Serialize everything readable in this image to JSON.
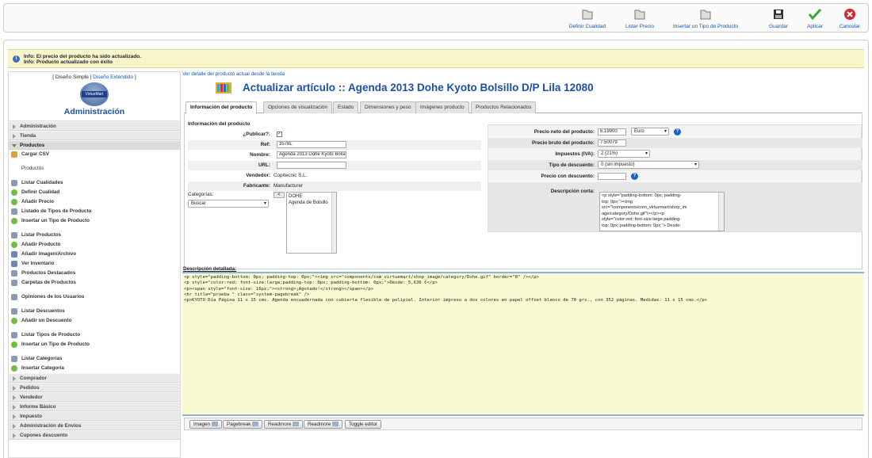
{
  "toolbar": {
    "buttons": [
      {
        "label": "Definir Cualidad",
        "icon": "folder-icon"
      },
      {
        "label": "Listar Precio",
        "icon": "folder-icon"
      },
      {
        "label": "Insertar un Tipo de Producto",
        "icon": "folder-icon"
      },
      {
        "label": "Guardar",
        "icon": "floppy-icon"
      },
      {
        "label": "Aplicar",
        "icon": "checkmark-icon"
      },
      {
        "label": "Cancelar",
        "icon": "cancel-icon"
      }
    ]
  },
  "messages": [
    "Info: El precio del producto ha sido actualizado.",
    "Info: Producto actualizado con éxito"
  ],
  "sidebar": {
    "design_simple": "Diseño Simple",
    "separator": " | ",
    "design_extended": "Diseño Extendido",
    "logo_text": "VirtueMart",
    "title": "Administración",
    "sections_top": [
      "Administración",
      "Tienda"
    ],
    "productos_label": "Productos",
    "productos_items": [
      {
        "label": "Cargar CSV",
        "icon": "c"
      },
      {
        "label": "Productos",
        "icon": ""
      },
      {
        "label": "Listar Cualidades",
        "icon": "d"
      },
      {
        "label": "Definir Cualidad",
        "icon": "g"
      },
      {
        "label": "Añadir Precio",
        "icon": "g"
      },
      {
        "label": "Listado de Tipos de Producto",
        "icon": "d"
      },
      {
        "label": "Insertar un Tipo de Producto",
        "icon": "g"
      },
      {
        "label": "Listar Productos",
        "icon": "d"
      },
      {
        "label": "Añadir Producto",
        "icon": "g"
      },
      {
        "label": "Añadir Imagen/Archivo",
        "icon": "p"
      },
      {
        "label": "Ver Inventario",
        "icon": "p"
      },
      {
        "label": "Productos Destacados",
        "icon": "d"
      },
      {
        "label": "Carpetas de Productos",
        "icon": "d"
      },
      {
        "label": "Opiniones de los Usuarios",
        "icon": "d"
      },
      {
        "label": "Listar Descuentos",
        "icon": "d"
      },
      {
        "label": "Añadir un Descuento",
        "icon": "g"
      },
      {
        "label": "Listar Tipos de Producto",
        "icon": "d"
      },
      {
        "label": "Insertar un Tipo de Producto",
        "icon": "g"
      },
      {
        "label": "Listar Categorías",
        "icon": "d"
      },
      {
        "label": "Insertar Categoría",
        "icon": "g"
      }
    ],
    "sections_bottom": [
      "Comprador",
      "Pedidos",
      "Vendedor",
      "Informe Básico",
      "Impuesto",
      "Administración de Envíos",
      "Cupones descuento"
    ]
  },
  "content": {
    "store_link": "Ver detalle del producto actual desde la tienda",
    "title": "Actualizar artículo :: Agenda 2013 Dohe Kyoto Bolsillo D/P Lila 12080",
    "tabs": [
      "Información del producto",
      "Opciones de visualización",
      "Estado",
      "Dimensiones y peso",
      "Imágenes producto",
      "Productos Relacionados"
    ],
    "info_title": "Información del producto",
    "publish_label": "¿Publicar?:",
    "ref_label": "Ref:",
    "ref_value": "3578L",
    "name_label": "Nombre:",
    "name_value": "Agenda 2013 Dohe Kyoto Bolsillo D/P Lila 12080",
    "url_label": "URL:",
    "url_value": "",
    "vendor_label": "Vendedor:",
    "vendor_value": "Copitecnic S.L.",
    "manufacturer_label": "Fabricante:",
    "manufacturer_value": "Manufacturer",
    "categories_label": "Categorías:",
    "search_value": "Buscar",
    "cat_button": "<",
    "categories": [
      "DOHE",
      "Agenda de Bolsillo"
    ],
    "net_price_label": "Precio neto del producto:",
    "net_price_value": "6.19900",
    "currency": "Euro",
    "gross_price_label": "Precio bruto del producto:",
    "gross_price_value": "7.50079",
    "tax_label": "Impuestos (IVA):",
    "tax_value": "2 (21%)",
    "discount_type_label": "Tipo de descuento:",
    "discount_type_value": "0 (sin impuesto)",
    "discount_price_label": "Precio con descuento:",
    "discount_price_value": "",
    "short_desc_label": "Descripción corta:",
    "short_desc_lines": [
      "<p style=\"padding-bottom: 0px; padding-",
      "top: 0px;\"><img",
      "src=\"/components/com_virtuemart/shop_im",
      "age/category/Dohe.gif\"/></p><p",
      "style=\"color:red; font-size:large;padding-",
      "top: 0px; padding-bottom: 0px;\"> Desde:"
    ],
    "long_desc_label": "Descripción detallada:",
    "long_desc_lines": [
      "<p style=\"padding-bottom: 0px; padding-top: 0px;\"><img src=\"components/com_virtuemart/shop_image/category/Dohe.gif\" border=\"0\" /></p>",
      "<p style=\"color:red; font-size:large;padding-top: 0px; padding-bottom: 0px;\">Desde: 5,636 €</p>",
      "<p><span style=\"font-size: 16px;\"><strong>¡Agotado!</strong></span></p>",
      "<hr title=\"prueba \" class=\"system-pagebreak\" />",
      "<p>KYOTO Día Página 11 x 15 cms. Agenda encuadernada con cubierta flexible de polipiel. Interior impreso a dos colores en papel offset blanco de 70 grs., con 352 páginas. Medidas: 11 x 15 cms.</p>"
    ],
    "editor_buttons": [
      "Imagen",
      "Pagebreak",
      "Readmore",
      "Readmore",
      "Toggle editor"
    ]
  }
}
